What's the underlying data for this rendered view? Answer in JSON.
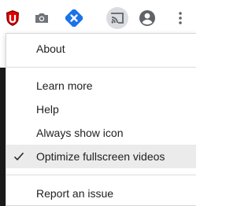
{
  "toolbar": {
    "icons": [
      "ublock-icon",
      "camera-icon",
      "extension-blue-icon",
      "cast-icon",
      "profile-icon",
      "more-vert-icon"
    ],
    "active_icon": "cast-icon",
    "colors": {
      "ublock": "#800000",
      "accent_blue": "#1a73e8",
      "icon_gray": "#5f6368"
    }
  },
  "menu": {
    "items": [
      {
        "label": "About",
        "checked": false
      },
      {
        "label": "Learn more",
        "checked": false
      },
      {
        "label": "Help",
        "checked": false
      },
      {
        "label": "Always show icon",
        "checked": false
      },
      {
        "label": "Optimize fullscreen videos",
        "checked": true
      },
      {
        "label": "Report an issue",
        "checked": false
      }
    ]
  }
}
